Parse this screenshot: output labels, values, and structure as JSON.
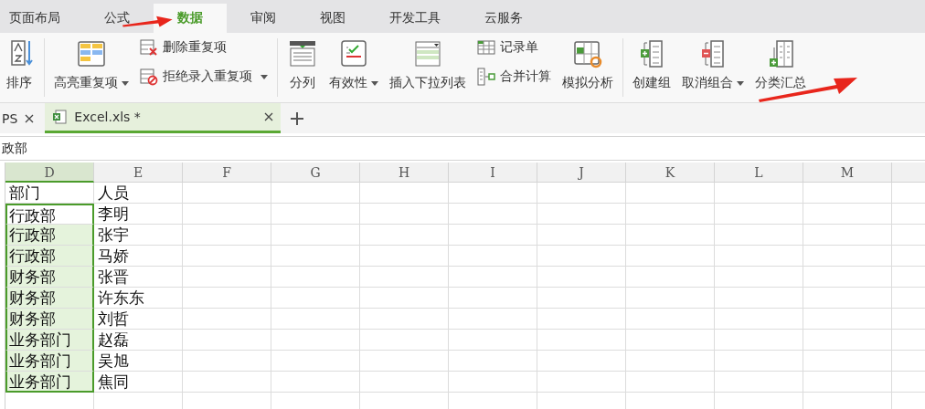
{
  "ribbon_tabs": [
    {
      "label": "页面布局",
      "selected": false
    },
    {
      "label": "公式",
      "selected": false
    },
    {
      "label": "数据",
      "selected": true
    },
    {
      "label": "审阅",
      "selected": false
    },
    {
      "label": "视图",
      "selected": false
    },
    {
      "label": "开发工具",
      "selected": false
    },
    {
      "label": "云服务",
      "selected": false
    }
  ],
  "ribbon_groups": [
    {
      "items": [
        {
          "kind": "large",
          "label": "排序",
          "dropdown": false
        }
      ]
    },
    {
      "items": [
        {
          "kind": "large",
          "label": "高亮重复项",
          "dropdown": true
        },
        {
          "kind": "stack",
          "items": [
            {
              "label": "删除重复项",
              "dropdown": false
            },
            {
              "label": "拒绝录入重复项",
              "dropdown": true
            }
          ]
        }
      ]
    },
    {
      "items": [
        {
          "kind": "large",
          "label": "分列",
          "dropdown": false
        },
        {
          "kind": "large",
          "label": "有效性",
          "dropdown": true
        },
        {
          "kind": "large",
          "label": "插入下拉列表",
          "dropdown": false
        },
        {
          "kind": "stack",
          "items": [
            {
              "label": "记录单",
              "dropdown": false
            },
            {
              "label": "合并计算",
              "dropdown": false
            }
          ]
        },
        {
          "kind": "large",
          "label": "模拟分析",
          "dropdown": false
        }
      ]
    },
    {
      "items": [
        {
          "kind": "large",
          "label": "创建组",
          "dropdown": false
        },
        {
          "kind": "large",
          "label": "取消组合",
          "dropdown": true
        },
        {
          "kind": "large",
          "label": "分类汇总",
          "dropdown": false
        }
      ]
    }
  ],
  "doc_tabs": [
    {
      "label": "PS",
      "selected": false
    },
    {
      "label": "Excel.xls *",
      "selected": true
    }
  ],
  "formula_bar": {
    "value": "政部"
  },
  "columns": [
    {
      "label": "D",
      "selected": true
    },
    {
      "label": "E",
      "selected": false
    },
    {
      "label": "F",
      "selected": false
    },
    {
      "label": "G",
      "selected": false
    },
    {
      "label": "H",
      "selected": false
    },
    {
      "label": "I",
      "selected": false
    },
    {
      "label": "J",
      "selected": false
    },
    {
      "label": "K",
      "selected": false
    },
    {
      "label": "L",
      "selected": false
    },
    {
      "label": "M",
      "selected": false
    }
  ],
  "rows": [
    {
      "cells": [
        "部门",
        "人员"
      ],
      "selected": false,
      "active": false
    },
    {
      "cells": [
        "行政部",
        "李明"
      ],
      "selected": true,
      "active": true
    },
    {
      "cells": [
        "行政部",
        "张宇"
      ],
      "selected": true,
      "active": false
    },
    {
      "cells": [
        "行政部",
        "马娇"
      ],
      "selected": true,
      "active": false
    },
    {
      "cells": [
        "财务部",
        "张晋"
      ],
      "selected": true,
      "active": false
    },
    {
      "cells": [
        "财务部",
        "许东东"
      ],
      "selected": true,
      "active": false
    },
    {
      "cells": [
        "财务部",
        "刘哲"
      ],
      "selected": true,
      "active": false
    },
    {
      "cells": [
        "业务部门",
        "赵磊"
      ],
      "selected": true,
      "active": false
    },
    {
      "cells": [
        "业务部门",
        "吴旭"
      ],
      "selected": true,
      "active": false
    },
    {
      "cells": [
        "业务部门",
        "焦同"
      ],
      "selected": true,
      "active": false
    }
  ]
}
